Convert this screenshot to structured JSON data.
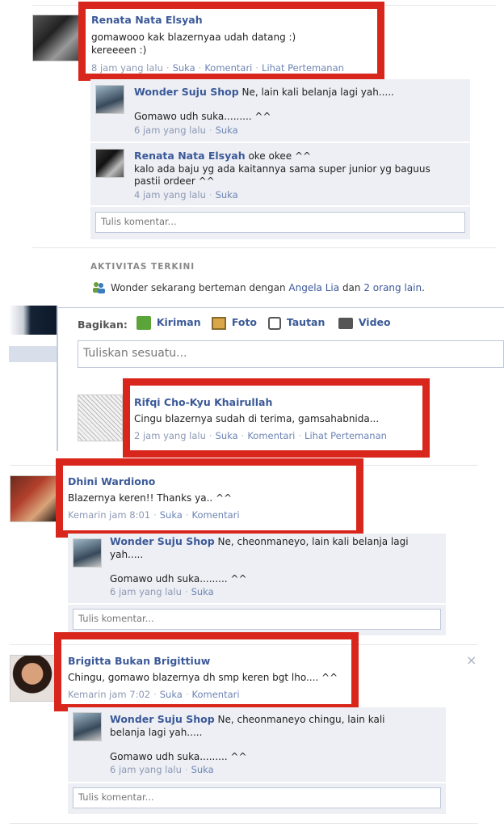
{
  "post1": {
    "author": "Renata Nata Elsyah",
    "text_l1": "gomawooo kak blazernyaa udah datang :)",
    "text_l2": "kereeeen :)",
    "time": "8 jam yang lalu",
    "like": "Suka",
    "comment": "Komentari",
    "friendship": "Lihat Pertemanan",
    "reply1": {
      "author": "Wonder Suju Shop",
      "text": "Ne, lain kali belanja lagi yah.....",
      "text2": "Gomawo udh suka......... ^^",
      "time": "6 jam yang lalu",
      "like": "Suka"
    },
    "reply2": {
      "author": "Renata Nata Elsyah",
      "text": "oke okee ^^",
      "text2": "kalo ada baju yg ada kaitannya sama super junior yg baguus",
      "text3": "pastii ordeer ^^",
      "time": "4 jam yang lalu",
      "like": "Suka"
    },
    "input_placeholder": "Tulis komentar..."
  },
  "activity": {
    "heading": "AKTIVITAS TERKINI",
    "prefix": "Wonder sekarang berteman dengan",
    "friend": "Angela Lia",
    "conj": "dan",
    "others": "2 orang lain",
    "period": "."
  },
  "share": {
    "label": "Bagikan:",
    "tabs": [
      "Kiriman",
      "Foto",
      "Tautan",
      "Video"
    ],
    "placeholder": "Tuliskan sesuatu..."
  },
  "post2": {
    "author": "Rifqi Cho-Kyu Khairullah",
    "text": "Cingu blazernya sudah di terima, gamsahabnida...",
    "time": "2 jam yang lalu",
    "like": "Suka",
    "comment": "Komentari",
    "friendship": "Lihat Pertemanan"
  },
  "post3": {
    "author": "Dhini Wardiono",
    "text": "Blazernya keren!! Thanks ya.. ^^",
    "time": "Kemarin jam 8:01",
    "like": "Suka",
    "comment": "Komentari",
    "reply": {
      "author": "Wonder Suju Shop",
      "text": "Ne, cheonmaneyo, lain kali belanja lagi",
      "text_cont": "yah.....",
      "text2": "Gomawo udh suka......... ^^",
      "time": "6 jam yang lalu",
      "like": "Suka"
    },
    "input_placeholder": "Tulis komentar..."
  },
  "post4": {
    "author": "Brigitta Bukan Brigittiuw",
    "text": "Chingu, gomawo blazernya dh smp keren bgt lho.... ^^",
    "time": "Kemarin jam 7:02",
    "like": "Suka",
    "comment": "Komentari",
    "close": "×",
    "reply": {
      "author": "Wonder Suju Shop",
      "text": "Ne, cheonmaneyo chingu, lain kali",
      "text_cont": "belanja lagi yah.....",
      "text2": "Gomawo udh suka......... ^^",
      "time": "6 jam yang lalu",
      "like": "Suka"
    },
    "input_placeholder": "Tulis komentar..."
  },
  "colors": {
    "highlight": "#d9261c",
    "link": "#3b5998",
    "comment_bg": "#edeff4"
  }
}
